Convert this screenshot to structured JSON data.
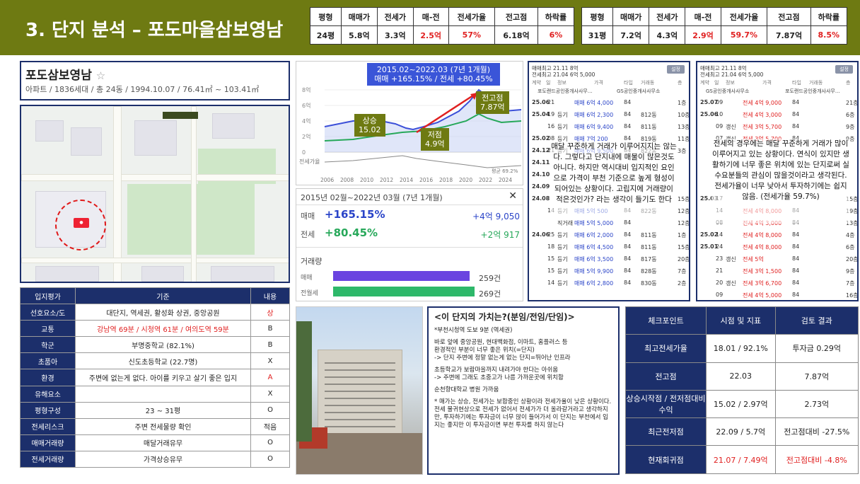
{
  "header": {
    "title": "3. 단지 분석 – 포도마을삼보영남",
    "summary_columns": [
      "평형",
      "매매가",
      "전세가",
      "매-전",
      "전세가율",
      "전고점",
      "하락률"
    ],
    "summary_left": [
      "24평",
      "5.8억",
      "3.3억",
      "2.5억",
      "57%",
      "6.18억",
      "6%"
    ],
    "summary_right": [
      "31평",
      "7.2억",
      "4.3억",
      "2.9억",
      "59.7%",
      "7.87억",
      "8.5%"
    ]
  },
  "apartment": {
    "name": "포도삼보영남",
    "star": "☆",
    "info": "아파트 / 1836세대 / 총 24동 / 1994.10.07 / 76.41㎡ ~ 103.41㎡"
  },
  "location_table": {
    "headers": [
      "입지평가",
      "기준",
      "내용"
    ],
    "rows": [
      {
        "key": "선호요소/도",
        "value": "대단지, 역세권, 활성화 상권, 중앙공원",
        "grade": "상"
      },
      {
        "key": "교통",
        "value": "강남역 69분 / 시청역 61분 / 여의도역 59분",
        "grade": "B"
      },
      {
        "key": "학군",
        "value": "부명중학교 (82.1%)",
        "grade": "B"
      },
      {
        "key": "초품아",
        "value": "신도초등학교 (22.7명)",
        "grade": "X"
      },
      {
        "key": "환경",
        "value": "주변에 없는게 없다. 아이를 키우고 살기 좋은 입지",
        "grade": "A"
      },
      {
        "key": "유해요소",
        "value": "",
        "grade": "X"
      },
      {
        "key": "평형구성",
        "value": "23 ~ 31평",
        "grade": "O"
      },
      {
        "key": "전세리스크",
        "value": "주변 전세물량 확인",
        "grade": "적음"
      },
      {
        "key": "매매거래량",
        "value": "매달거래유무",
        "grade": "O"
      },
      {
        "key": "전세거래량",
        "value": "가격상승유무",
        "grade": "O"
      }
    ]
  },
  "chart": {
    "header_line1": "2015.02~2022.03 (7년 1개월)",
    "header_line2": "매매 +165.15% / 전세 +80.45%",
    "y_ticks": [
      "8억",
      "6억",
      "4억",
      "2억",
      "0"
    ],
    "x_ticks": [
      "2006",
      "2008",
      "2010",
      "2012",
      "2014",
      "2016",
      "2018",
      "2020",
      "2022",
      "2024"
    ],
    "bottom_label": "전세가율",
    "bottom_value": "평균 69.2%",
    "callouts": {
      "rise_label": "상승",
      "rise_value": "15.02",
      "low_label": "저점",
      "low_value": "4.9억",
      "peak_label": "전고점",
      "peak_value": "7.87억"
    }
  },
  "stats": {
    "period": "2015년 02월~2022년 03월 (7년 1개월)",
    "close": "✕",
    "sale_label": "매매",
    "sale_pct": "+165.15%",
    "sale_amt": "+4억 9,050",
    "jeonse_label": "전세",
    "jeonse_pct": "+80.45%",
    "jeonse_amt": "+2억 917",
    "volume_title": "거래량",
    "sale_volume_label": "매매",
    "sale_volume": "259건",
    "jeonse_volume_label": "전월세",
    "jeonse_volume": "269건",
    "sale_volume_n": 259,
    "jeonse_volume_n": 269
  },
  "trade_left": {
    "peak": "매매최고 21.11 8억",
    "jeonse_peak": "전세최고 21.04 6억 5,000",
    "setting": "설정",
    "cols": [
      "계약",
      "일",
      "정보",
      "가격",
      "타입",
      "거래동",
      "층"
    ],
    "agent_a": "포도랜드공인중개사사무...",
    "agent_b": "GS공인중개사사무소",
    "rows": [
      {
        "ym": "25.06",
        "d": "21",
        "k": "",
        "p": "매매 6억 4,000",
        "t": "84",
        "dong": "",
        "f": "1층"
      },
      {
        "ym": "25.04",
        "d": "19",
        "k": "등기",
        "p": "매매 6억 2,300",
        "t": "84",
        "dong": "812동",
        "f": "10층"
      },
      {
        "ym": "",
        "d": "16",
        "k": "등기",
        "p": "매매 6억 9,400",
        "t": "84",
        "dong": "811동",
        "f": "13층"
      },
      {
        "ym": "25.02",
        "d": "08",
        "k": "등기",
        "p": "매매 7억 200",
        "t": "84",
        "dong": "819동",
        "f": "11층"
      },
      {
        "ym": "24.12",
        "d": "21",
        "k": "등기",
        "p": "매매 6억 9,500",
        "t": "84",
        "dong": "822동",
        "f": "3층"
      },
      {
        "ym": "24.11",
        "d": "",
        "k": "",
        "p": "",
        "t": "",
        "dong": "",
        "f": ""
      },
      {
        "ym": "24.10",
        "d": "",
        "k": "",
        "p": "",
        "t": "",
        "dong": "",
        "f": ""
      },
      {
        "ym": "24.09",
        "d": "",
        "k": "",
        "p": "",
        "t": "",
        "dong": "",
        "f": ""
      },
      {
        "ym": "24.08",
        "d": "",
        "k": "",
        "p": "",
        "t": "",
        "dong": "",
        "f": "15층"
      },
      {
        "ym": "",
        "d": "14",
        "k": "등기",
        "p": "매매 5억 500",
        "t": "84",
        "dong": "822동",
        "f": "12층"
      },
      {
        "ym": "",
        "d": "",
        "k": "직거래",
        "p": "매매 5억 5,000",
        "t": "84",
        "dong": "",
        "f": "12층"
      },
      {
        "ym": "24.06",
        "d": "25",
        "k": "등기",
        "p": "매매 6억 2,000",
        "t": "84",
        "dong": "811동",
        "f": "1층"
      },
      {
        "ym": "",
        "d": "18",
        "k": "등기",
        "p": "매매 6억 4,500",
        "t": "84",
        "dong": "811동",
        "f": "15층"
      },
      {
        "ym": "",
        "d": "15",
        "k": "등기",
        "p": "매매 6억 3,500",
        "t": "84",
        "dong": "817동",
        "f": "20층"
      },
      {
        "ym": "",
        "d": "15",
        "k": "등기",
        "p": "매매 5억 9,900",
        "t": "84",
        "dong": "828동",
        "f": "7층"
      },
      {
        "ym": "",
        "d": "14",
        "k": "등기",
        "p": "매매 6억 2,800",
        "t": "84",
        "dong": "830동",
        "f": "2층"
      }
    ],
    "overlay": "매달 꾸준하게 거래가 이루어지지는 않는다. 그렇다고 단지내에 매물이 많은것도 아니다. 하지만 역시대비 입지적인 요인으로 가격이 부천 기준으로 높게 형성이 되어있는 상황이다. 고립지에 거래량이 적은것인가? 라는 생각이 들기도 한다"
  },
  "trade_right": {
    "peak": "매매최고 21.11 8억",
    "jeonse_peak": "전세최고 21.04 6억 5,000",
    "setting": "설정",
    "cols": [
      "계약",
      "일",
      "정보",
      "가격",
      "타입",
      "거래동",
      "층"
    ],
    "agent_a": "GS공인중개사사무소",
    "agent_b": "포도랜드공인중개사사무...",
    "rows": [
      {
        "ym": "25.07",
        "d": "09",
        "k": "",
        "p": "전세 4억 9,000",
        "t": "84",
        "f": "21층"
      },
      {
        "ym": "25.06",
        "d": "10",
        "k": "",
        "p": "전세 4억 3,000",
        "t": "84",
        "f": "6층"
      },
      {
        "ym": "",
        "d": "09",
        "k": "갱신",
        "p": "전세 3억 5,700",
        "t": "84",
        "f": "9층"
      },
      {
        "ym": "",
        "d": "07",
        "k": "갱신",
        "p": "전세 3억 5,700",
        "t": "84",
        "f": "9층"
      },
      {
        "ym": "",
        "d": "",
        "k": "",
        "p": "",
        "t": "",
        "f": ""
      },
      {
        "ym": "",
        "d": "",
        "k": "",
        "p": "",
        "t": "",
        "f": ""
      },
      {
        "ym": "",
        "d": "",
        "k": "",
        "p": "",
        "t": "",
        "f": ""
      },
      {
        "ym": "",
        "d": "",
        "k": "",
        "p": "",
        "t": "",
        "f": ""
      },
      {
        "ym": "25.03",
        "d": "17",
        "k": "",
        "p": "",
        "t": "",
        "f": "15층"
      },
      {
        "ym": "",
        "d": "14",
        "k": "",
        "p": "전세 4억 8,000",
        "t": "84",
        "f": "19층"
      },
      {
        "ym": "",
        "d": "08",
        "k": "",
        "p": "전세 4억 3,000",
        "t": "84",
        "f": "13층"
      },
      {
        "ym": "25.02",
        "d": "14",
        "k": "",
        "p": "전세 4억 8,000",
        "t": "84",
        "f": "4층"
      },
      {
        "ym": "25.01",
        "d": "24",
        "k": "",
        "p": "전세 4억 8,000",
        "t": "84",
        "f": "6층"
      },
      {
        "ym": "",
        "d": "23",
        "k": "갱신",
        "p": "전세 5억",
        "t": "84",
        "f": "20층"
      },
      {
        "ym": "",
        "d": "21",
        "k": "",
        "p": "전세 3억 1,500",
        "t": "84",
        "f": "9층"
      },
      {
        "ym": "",
        "d": "20",
        "k": "갱신",
        "p": "전세 3억 6,700",
        "t": "84",
        "f": "7층"
      },
      {
        "ym": "",
        "d": "09",
        "k": "",
        "p": "전세 4억 5,000",
        "t": "84",
        "f": "16층"
      }
    ],
    "overlay": "전세의 경우에는 매달 꾸준하게 거래가 많이 이루어지고 있는 상황이다. 연식이 있지만 생활하기에 너무 좋은 위치에 있는 단지로써 실수요분들의 관심이 많을것이라고 생각된다. 전세가율이 너무 낮아서 투자하기에는 쉽지 않음. (전세가율 59.7%)"
  },
  "value": {
    "title": "<이 단지의 가치는?(분임/전임/단임)>",
    "p1": "*부천시청역 도보 9분 (역세권)",
    "p2": "바로 앞에 중앙공원, 현대백화점, 이마트, 홈플러스 등\n환경적인 부분이 너무 좋은 위치(=단지)\n-> 단지 주변에 정말 없는게 없는 단지=뛰어난 인프라",
    "p3": "초등학교가 보람마을까지 내려가야 한다는 아쉬움\n-> 주변에 그래도 초중고가 나름 가까운곳에 위치함",
    "p4": "순천향대학교 병원 가까움",
    "p5": "* 매가는 상승, 전세가는 보합중인 상황이라 전세가율이 낮은 상황이다. 전세 물귀현상으로 전세가 없어서 전세가가 더 올라갈거라고 생각하지만, 투자하기에는 투자금이 너무 많이 들어가서 이 단지는 부천에서 입지는 좋지만 이 투자금이면 부천 투자를 하지 않는다"
  },
  "checkpoint": {
    "headers": [
      "체크포인트",
      "시점 및 지표",
      "검토 결과"
    ],
    "rows": [
      {
        "k": "최고전세가율",
        "a": "18.01 / 92.1%",
        "b": "투자금 0.29억",
        "red": false
      },
      {
        "k": "전고점",
        "a": "22.03",
        "b": "7.87억",
        "red": false
      },
      {
        "k": "상승시작점 / 전저점대비 수익",
        "a": "15.02 / 2.97억",
        "b": "2.73억",
        "red": false
      },
      {
        "k": "최근전저점",
        "a": "22.09 / 5.7억",
        "b": "전고점대비 -27.5%",
        "red": false
      },
      {
        "k": "현재회귀점",
        "a": "21.07 / 7.49억",
        "b": "전고점대비 -4.8%",
        "red": true
      }
    ]
  },
  "colors": {
    "header_bg": "#6e7a12",
    "navy": "#1c2f6b",
    "red": "#e02020",
    "sale_blue": "#2a44c8",
    "jeonse_green": "#27a85a"
  }
}
